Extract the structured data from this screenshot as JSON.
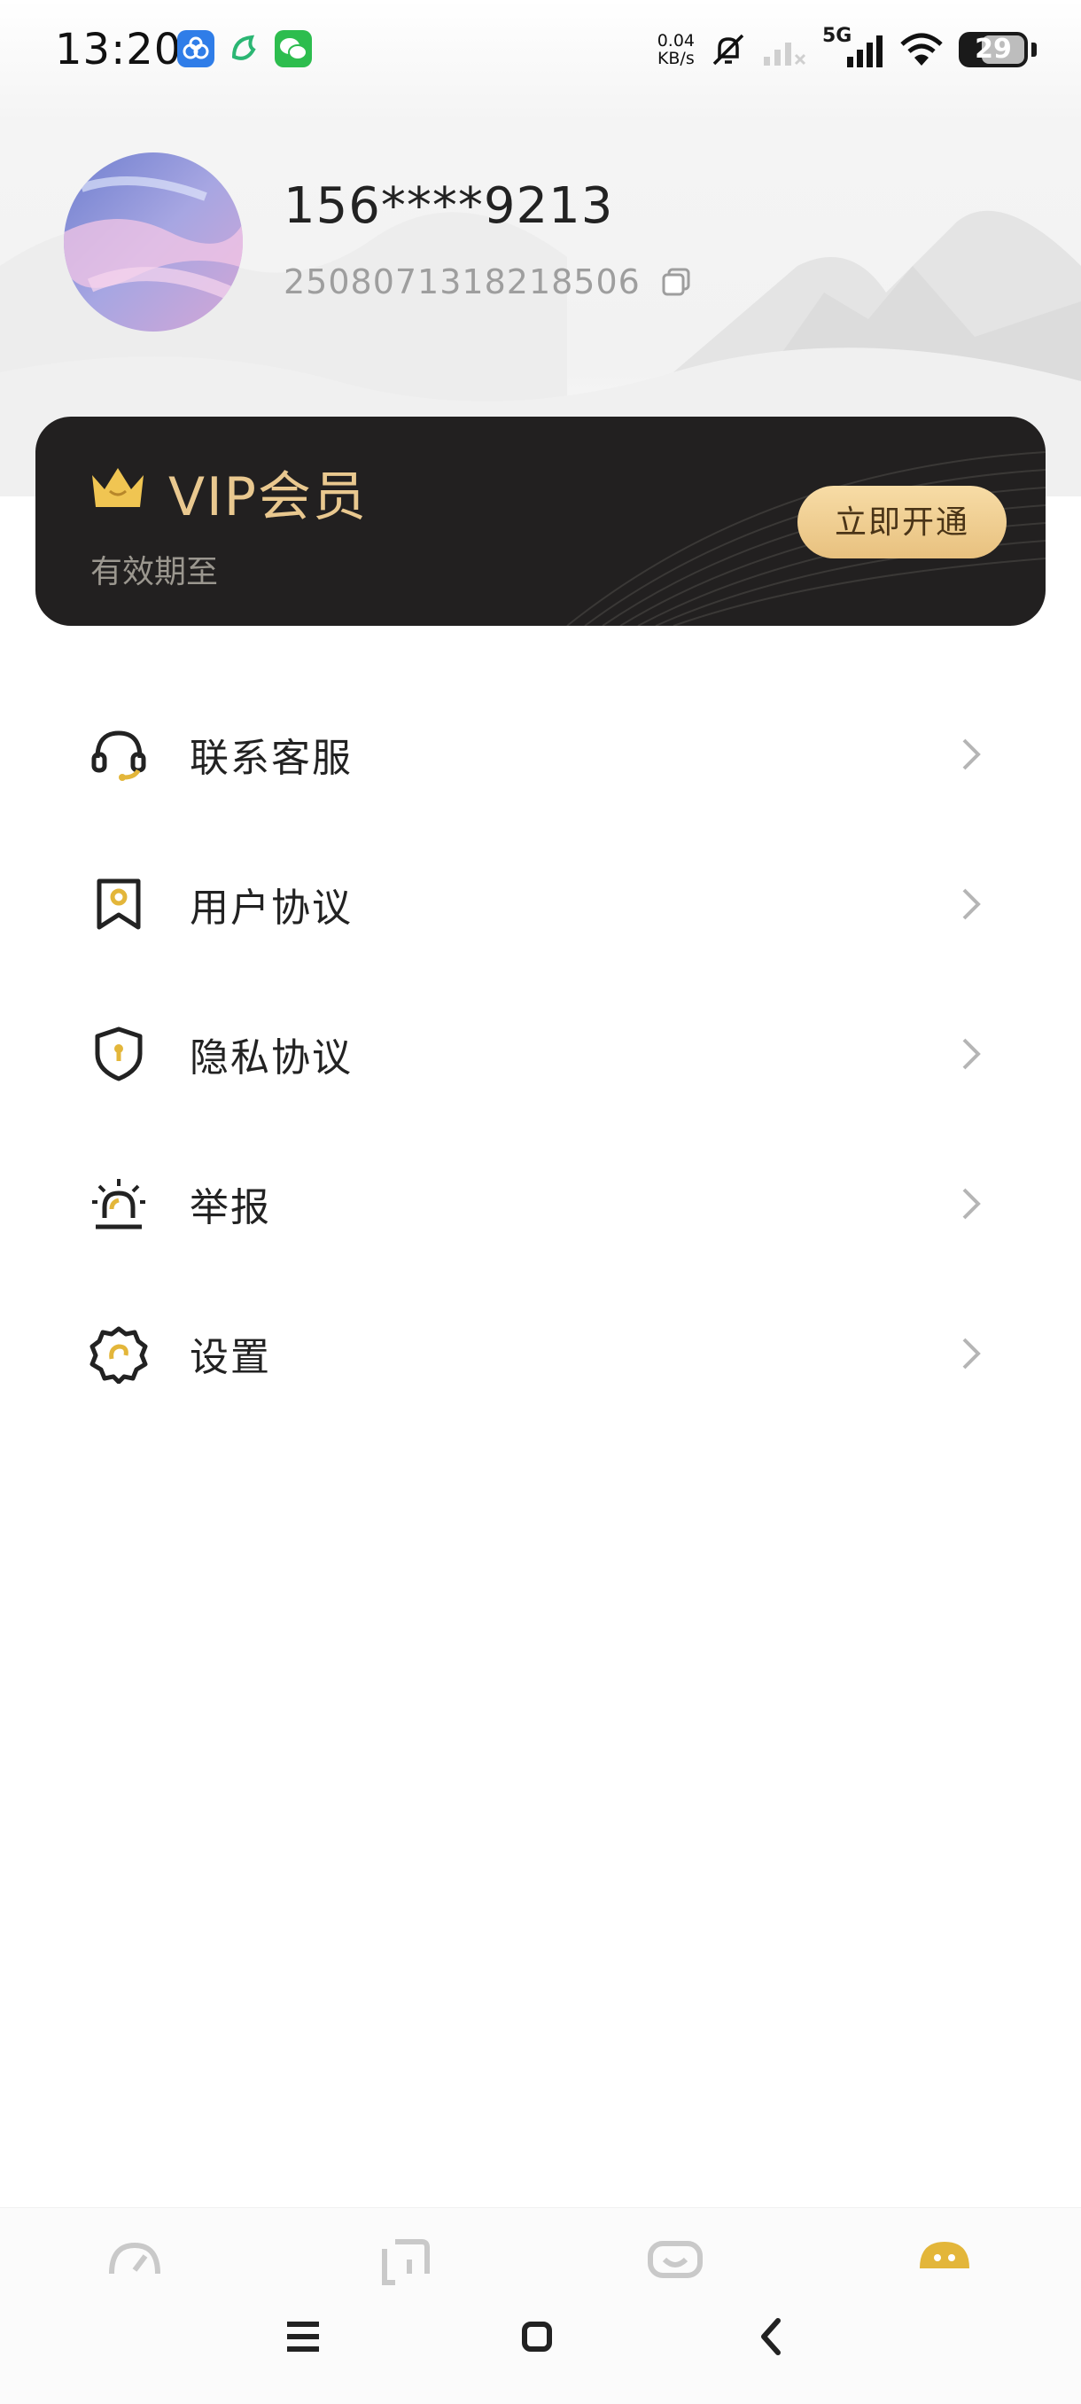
{
  "status_bar": {
    "time": "13:20",
    "net_speed_value": "0.04",
    "net_speed_unit": "KB/s",
    "network_label": "5G",
    "battery": "29",
    "icons": [
      "cloud-app-icon",
      "leaf-app-icon",
      "wechat-icon",
      "mute-bell-icon",
      "signal-icon",
      "signal-5g-icon",
      "wifi-icon",
      "battery-icon"
    ]
  },
  "profile": {
    "phone": "156****9213",
    "user_id": "2508071318218506"
  },
  "vip": {
    "title": "VIP会员",
    "subtitle": "有效期至",
    "button_label": "立即开通",
    "accent": "#e9c88f"
  },
  "menu": {
    "items": [
      {
        "label": "联系客服",
        "icon": "headset-icon"
      },
      {
        "label": "用户协议",
        "icon": "bookmark-icon"
      },
      {
        "label": "隐私协议",
        "icon": "shield-icon"
      },
      {
        "label": "举报",
        "icon": "alarm-icon"
      },
      {
        "label": "设置",
        "icon": "gear-icon"
      }
    ]
  },
  "bottom_nav": {
    "tabs": [
      {
        "icon": "dashboard-icon"
      },
      {
        "icon": "bracket-icon"
      },
      {
        "icon": "chat-icon"
      },
      {
        "icon": "profile-face-icon",
        "active": true
      }
    ],
    "active_color": "#e3b63a"
  }
}
